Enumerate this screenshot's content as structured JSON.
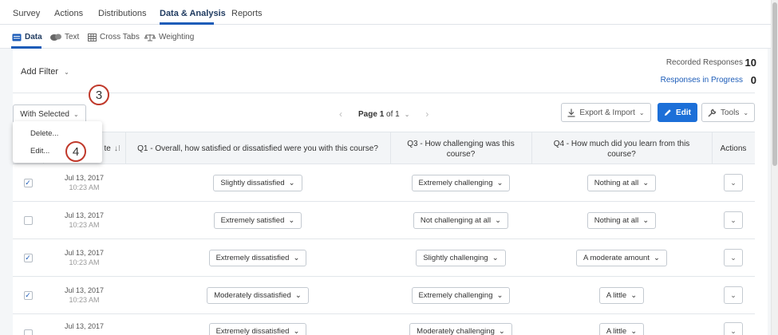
{
  "topnav": {
    "tabs": [
      {
        "label": "Survey"
      },
      {
        "label": "Actions"
      },
      {
        "label": "Distributions"
      },
      {
        "label": "Data & Analysis"
      },
      {
        "label": "Reports"
      }
    ],
    "active": "Data & Analysis"
  },
  "subnav": {
    "tabs": [
      {
        "label": "Data",
        "icon": "data-icon"
      },
      {
        "label": "Text",
        "icon": "text-icon"
      },
      {
        "label": "Cross Tabs",
        "icon": "cross-tabs-icon"
      },
      {
        "label": "Weighting",
        "icon": "weighting-icon"
      }
    ]
  },
  "filter": {
    "label": "Add Filter"
  },
  "stats": {
    "recorded_label": "Recorded Responses",
    "recorded_value": "10",
    "progress_label": "Responses in Progress",
    "progress_value": "0"
  },
  "toolbar": {
    "with_selected": "With Selected",
    "page_prefix": "Page",
    "page_current": "1",
    "page_of": "of 1",
    "export": "Export & Import",
    "edit": "Edit",
    "tools": "Tools"
  },
  "menu": {
    "items": [
      "Delete...",
      "Edit..."
    ]
  },
  "badges": [
    "3",
    "4"
  ],
  "table": {
    "headers": {
      "date": "te",
      "q1": "Q1 - Overall, how satisfied or dissatisfied were you with this course?",
      "q3": "Q3 - How challenging was this course?",
      "q4": "Q4 - How much did you learn from this course?",
      "actions": "Actions"
    },
    "rows": [
      {
        "checked": "✓",
        "date": "Jul 13, 2017",
        "time": "10:23 AM",
        "q1": "Slightly dissatisfied",
        "q3": "Extremely challenging",
        "q4": "Nothing at all"
      },
      {
        "checked": "",
        "date": "Jul 13, 2017",
        "time": "10:23 AM",
        "q1": "Extremely satisfied",
        "q3": "Not challenging at all",
        "q4": "Nothing at all"
      },
      {
        "checked": "✓",
        "date": "Jul 13, 2017",
        "time": "10:23 AM",
        "q1": "Extremely dissatisfied",
        "q3": "Slightly challenging",
        "q4": "A moderate amount"
      },
      {
        "checked": "✓",
        "date": "Jul 13, 2017",
        "time": "10:23 AM",
        "q1": "Moderately dissatisfied",
        "q3": "Extremely challenging",
        "q4": "A little"
      },
      {
        "checked": "",
        "date": "Jul 13, 2017",
        "time": "",
        "q1": "Extremely dissatisfied",
        "q3": "Moderately challenging",
        "q4": "A little"
      }
    ]
  },
  "colors": {
    "accent": "#1c6fd8",
    "badge": "#c0392b"
  }
}
